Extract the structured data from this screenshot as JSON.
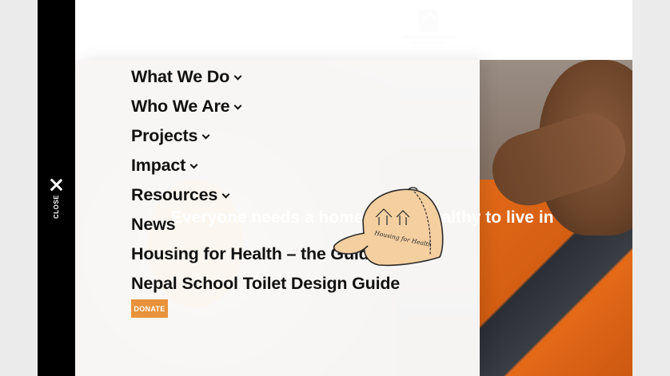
{
  "site": {
    "hero_text": "Everyone needs a home that is healthy to live in"
  },
  "menu": {
    "items": [
      {
        "label": "What We Do",
        "has_submenu": true
      },
      {
        "label": "Who We Are",
        "has_submenu": true
      },
      {
        "label": "Projects",
        "has_submenu": true
      },
      {
        "label": "Impact",
        "has_submenu": true
      },
      {
        "label": "Resources",
        "has_submenu": true
      },
      {
        "label": "News",
        "has_submenu": false
      },
      {
        "label": "Housing for Health – the Guide",
        "has_submenu": false
      },
      {
        "label": "Nepal School Toilet Design Guide",
        "has_submenu": false
      }
    ],
    "donate_label": "DONATE"
  },
  "close": {
    "label": "CLOSE",
    "icon": "close-icon"
  },
  "cap": {
    "text": "Housing for Health",
    "color": "#f4cfa0"
  },
  "colors": {
    "donate_bg": "#e8923a",
    "sidebar_bg": "#000000",
    "menu_text": "#111111"
  }
}
